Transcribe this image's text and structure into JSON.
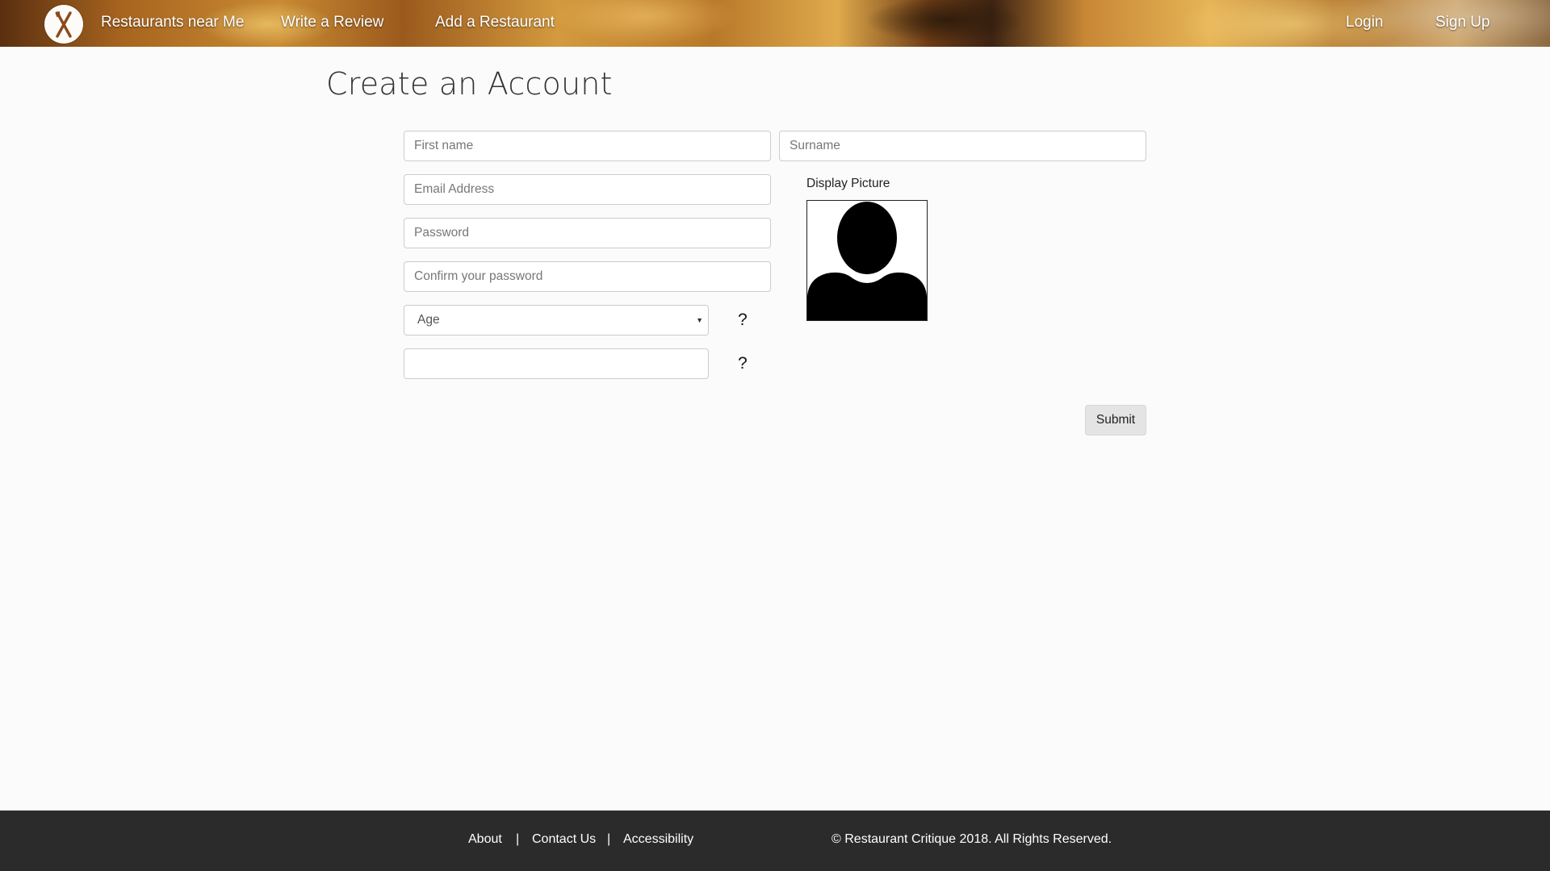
{
  "nav": {
    "links": {
      "restaurants_near_me": "Restaurants near Me",
      "write_review": "Write a Review",
      "add_restaurant": "Add a Restaurant",
      "login": "Login",
      "signup": "Sign Up"
    },
    "logo_icon": "fork-knife-icon"
  },
  "page": {
    "title": "Create an Account"
  },
  "form": {
    "first_name_placeholder": "First name",
    "surname_placeholder": "Surname",
    "email_placeholder": "Email Address",
    "password_placeholder": "Password",
    "confirm_password_placeholder": "Confirm your password",
    "age_selected": "Age",
    "extra_field_value": "",
    "help_symbol": "?",
    "display_picture_label": "Display Picture",
    "display_picture_icon": "user-silhouette-icon",
    "submit_label": "Submit"
  },
  "footer": {
    "about": "About",
    "separator": "|",
    "contact": "Contact Us",
    "accessibility": "Accessibility",
    "copyright": "© Restaurant Critique 2018. All Rights Reserved."
  },
  "colors": {
    "background": "#fbfbfb",
    "footer": "#2b2b2b",
    "submit": "#e4e4e4",
    "logo_accent": "#8a4a1c"
  }
}
